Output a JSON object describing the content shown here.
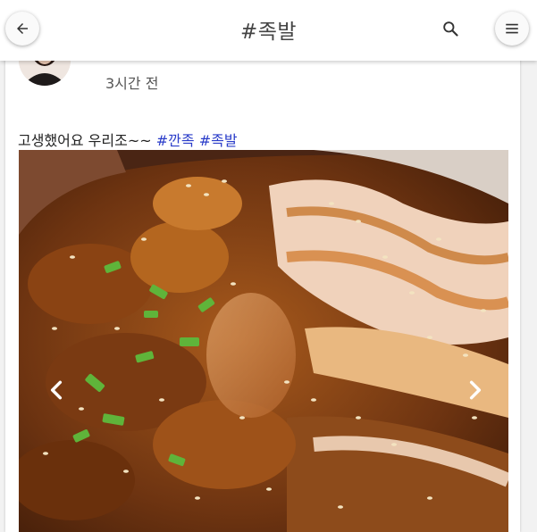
{
  "header": {
    "title": "#족발",
    "back_icon": "arrow-back-icon",
    "search_icon": "search-icon",
    "menu_icon": "hamburger-menu-icon"
  },
  "post": {
    "time": "3시간 전",
    "text": "고생했어요 우리조~~",
    "tags": [
      "#깐족",
      "#족발"
    ]
  },
  "carousel": {
    "prev_icon": "chevron-left-icon",
    "next_icon": "chevron-right-icon"
  },
  "colors": {
    "hashtag": "#2a3cc9",
    "appbar": "#ffffff",
    "page_background": "#f2f2f2"
  }
}
